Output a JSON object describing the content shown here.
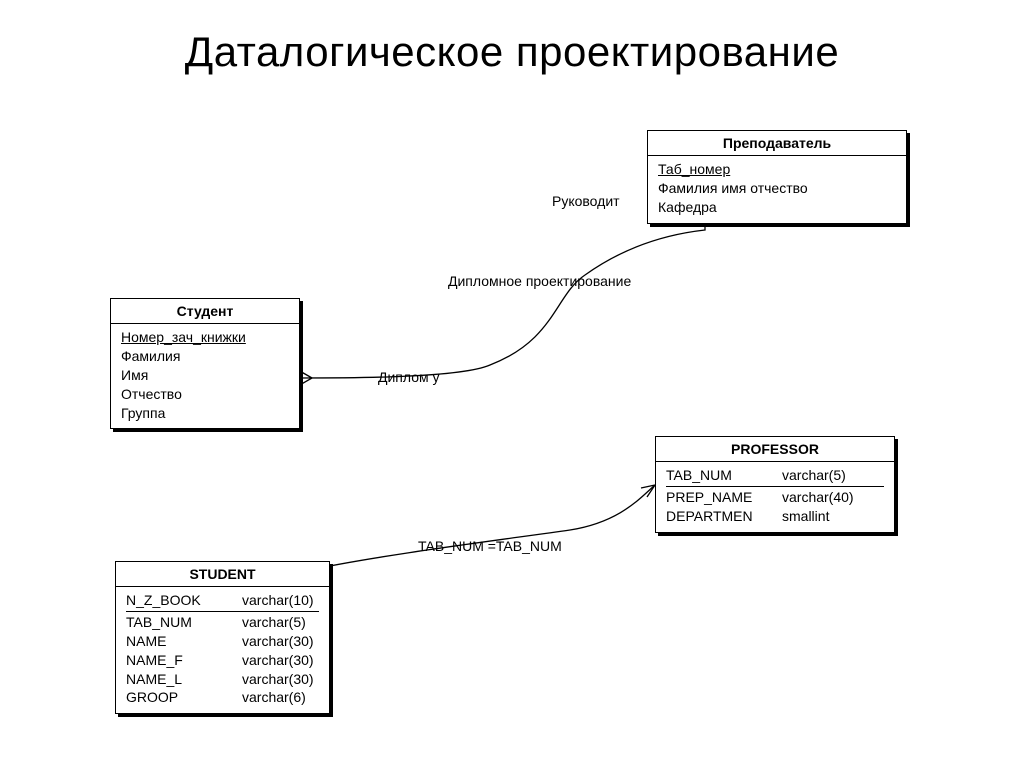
{
  "title": "Даталогическое проектирование",
  "labels": {
    "supervises": "Руководит",
    "diploma_design": "Дипломное проектирование",
    "diploma_to": "Диплом у",
    "fk_relation": "TAB_NUM =TAB_NUM"
  },
  "entities": {
    "teacher": {
      "title": "Преподаватель",
      "attrs": [
        "Таб_номер",
        "Фамилия имя отчество",
        "Кафедра"
      ],
      "pk_indexes": [
        0
      ]
    },
    "student": {
      "title": "Студент",
      "attrs": [
        "Номер_зач_книжки",
        "Фамилия",
        "Имя",
        "Отчество",
        "Группа"
      ],
      "pk_indexes": [
        0
      ]
    },
    "professor": {
      "title": "PROFESSOR",
      "rows": [
        {
          "name": "TAB_NUM",
          "type": "varchar(5)",
          "pk": true
        },
        {
          "name": "PREP_NAME",
          "type": "varchar(40)"
        },
        {
          "name": "DEPARTMEN",
          "type": "smallint"
        }
      ]
    },
    "student_tbl": {
      "title": "STUDENT",
      "rows": [
        {
          "name": "N_Z_BOOK",
          "type": "varchar(10)",
          "pk": true
        },
        {
          "name": "TAB_NUM",
          "type": "varchar(5)",
          "sep": true
        },
        {
          "name": "NAME",
          "type": "varchar(30)"
        },
        {
          "name": "NAME_F",
          "type": "varchar(30)"
        },
        {
          "name": "NAME_L",
          "type": "varchar(30)"
        },
        {
          "name": "GROOP",
          "type": "varchar(6)"
        }
      ]
    }
  }
}
